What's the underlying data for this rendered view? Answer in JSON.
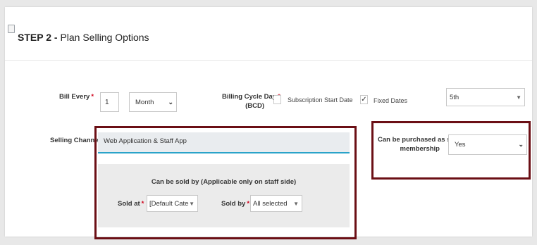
{
  "header": {
    "step_label": "STEP 2 -",
    "step_title": "Plan Selling Options"
  },
  "bill_every": {
    "label": "Bill Every",
    "value": "1",
    "unit_selected": "Month"
  },
  "billing_cycle": {
    "label_line1": "Billing Cycle Day",
    "label_line2": "(BCD)",
    "option_subscription": "Subscription Start Date",
    "option_subscription_checked": false,
    "option_fixed": "Fixed Dates",
    "option_fixed_checked": true,
    "checkmark": "✓",
    "day_selected": "5th"
  },
  "selling_channel": {
    "label": "Selling Channel",
    "value": "Web Application & Staff App"
  },
  "sold_by_panel": {
    "title": "Can be sold by (Applicable only on staff side)",
    "sold_at_label": "Sold at",
    "sold_at_value": "[Default Categori...",
    "sold_by_label": "Sold by",
    "sold_by_value": "All selected"
  },
  "single_membership": {
    "label_line1": "Can be purchased as single",
    "label_line2": "membership",
    "value": "Yes"
  },
  "required_marker": "*",
  "colors": {
    "highlight_border": "#6b0f15",
    "required": "#d0021b",
    "channel_underline": "#2aa3c9"
  },
  "icons": {
    "dropdown": "chevron-down-icon",
    "dropdown_triangle": "caret-down-icon"
  }
}
